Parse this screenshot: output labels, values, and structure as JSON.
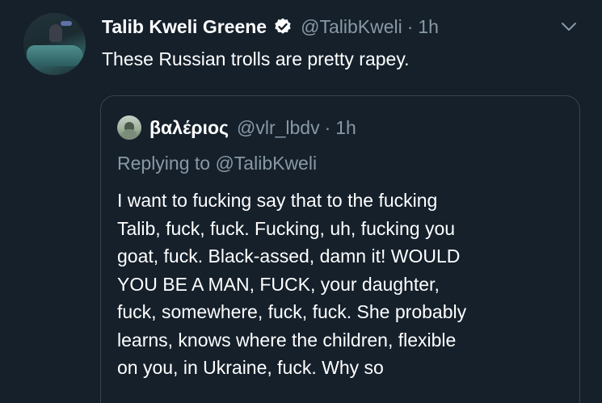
{
  "tweet": {
    "display_name": "Talib Kweli Greene",
    "handle": "@TalibKweli",
    "separator": "·",
    "time": "1h",
    "text": "These Russian trolls are pretty rapey.",
    "verified_icon": "verified-badge-icon",
    "menu_icon": "chevron-down-icon"
  },
  "quoted_tweet": {
    "display_name": "βαλέριος",
    "handle": "@vlr_lbdv",
    "separator": "·",
    "time": "1h",
    "replying_to": "Replying to @TalibKweli",
    "text_lines": [
      "I want to fucking say that to the fucking",
      "Talib, fuck, fuck. Fucking, uh, fucking you",
      "goat, fuck. Black-assed, damn it! WOULD",
      "YOU BE A MAN, FUCK, your daughter,",
      "fuck, somewhere, fuck, fuck. She probably",
      "learns, knows where the children, flexible",
      "on you, in Ukraine, fuck. Why so"
    ]
  },
  "colors": {
    "background": "#15202b",
    "secondary_text": "#8899a6",
    "border": "#38444d",
    "primary_text": "#ffffff"
  }
}
